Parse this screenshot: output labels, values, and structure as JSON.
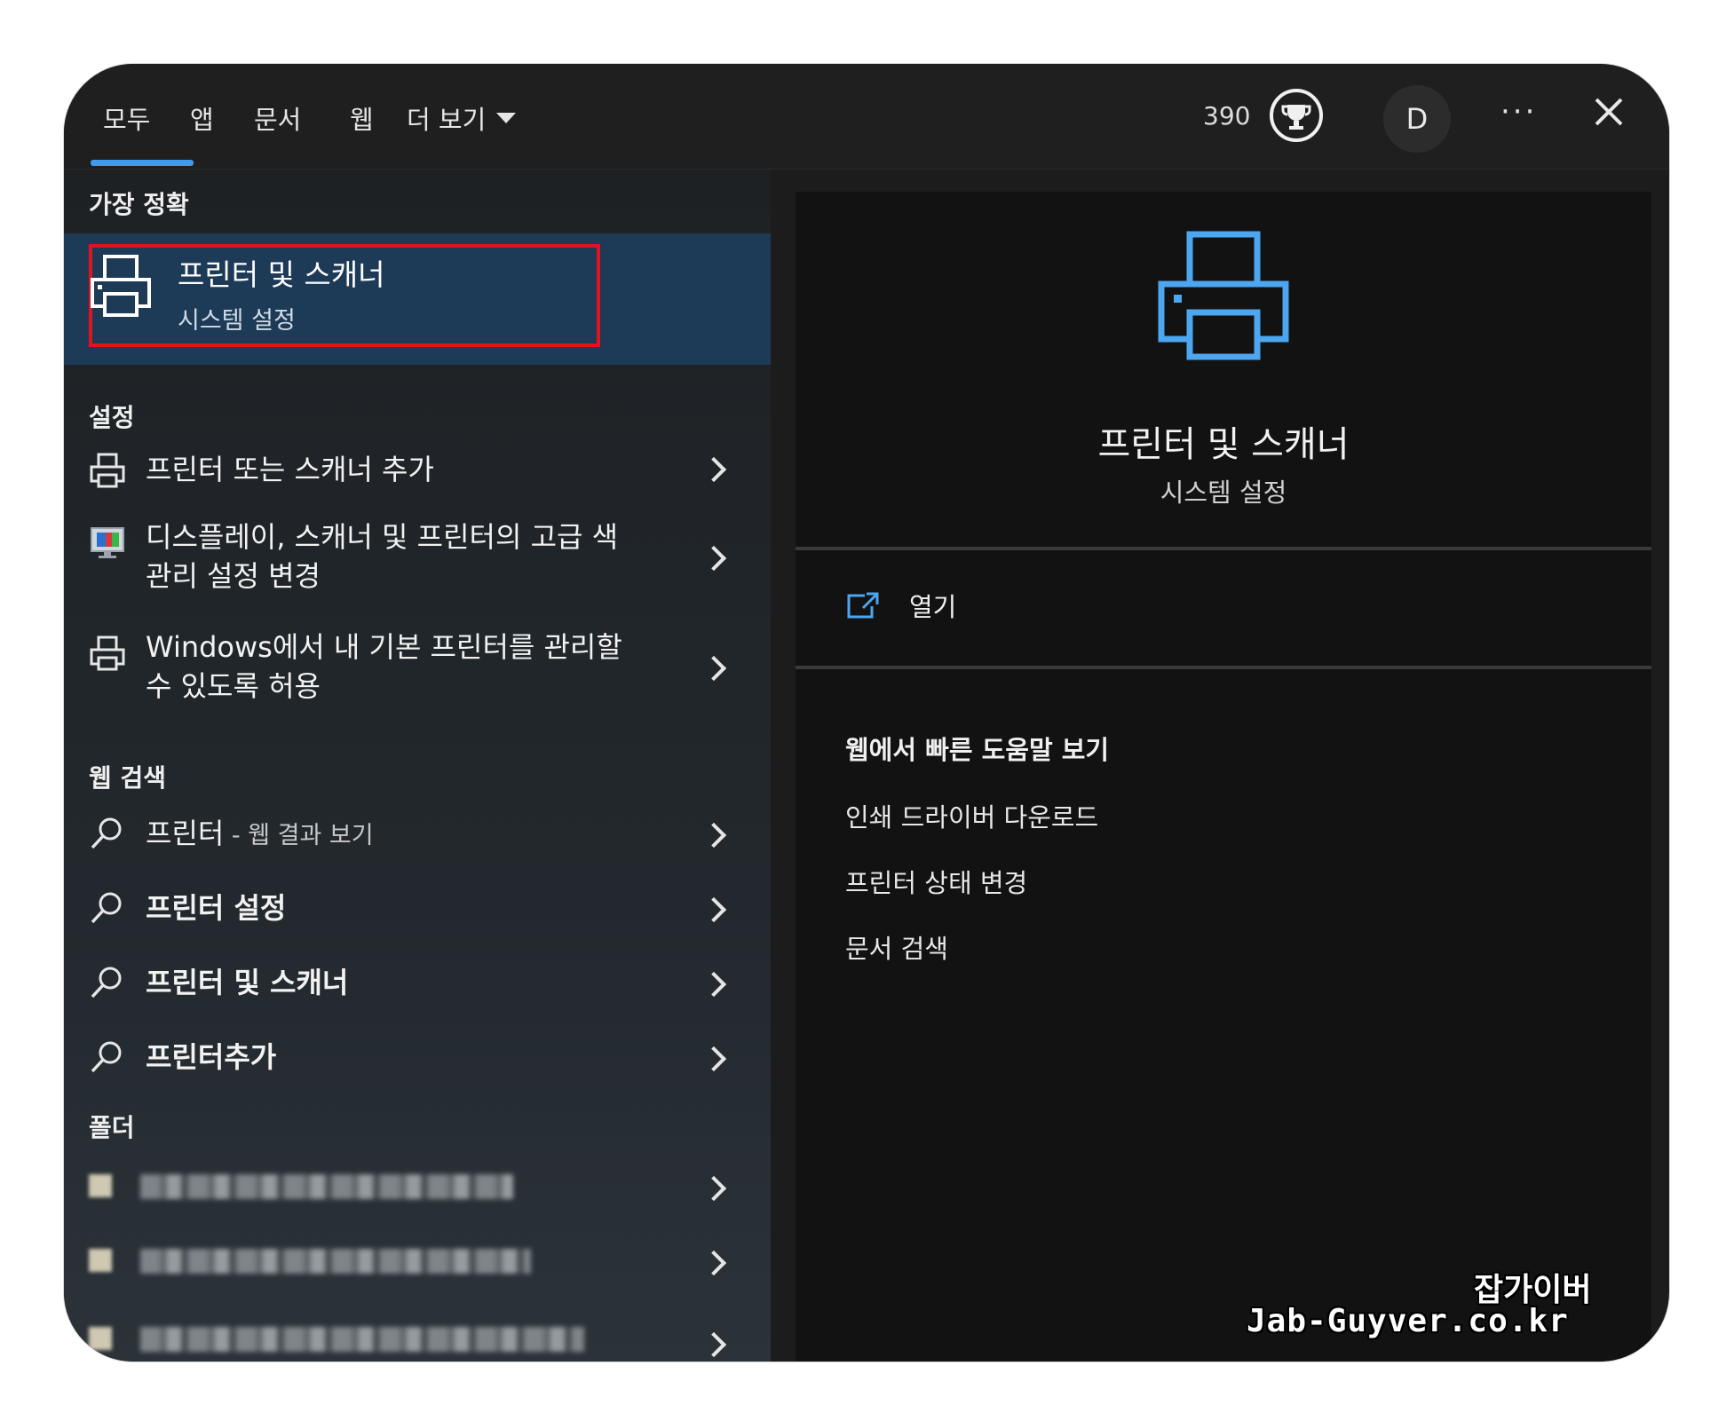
{
  "tabs": [
    {
      "label": "모두"
    },
    {
      "label": "앱"
    },
    {
      "label": "문서"
    },
    {
      "label": "웹"
    },
    {
      "label": "더 보기"
    }
  ],
  "header": {
    "points": "390",
    "avatar_initial": "D"
  },
  "left": {
    "best_match_title": "가장 정확",
    "best_match": {
      "title": "프린터 및 스캐너",
      "subtitle": "시스템 설정"
    },
    "settings_title": "설정",
    "settings_items": [
      {
        "label": "프린터 또는 스캐너 추가",
        "icon": "printer-icon"
      },
      {
        "label": "디스플레이, 스캐너 및 프린터의 고급 색 관리 설정 변경",
        "icon": "display-color-icon"
      },
      {
        "label": "Windows에서 내 기본 프린터를 관리할 수 있도록 허용",
        "icon": "printer-icon"
      }
    ],
    "web_title": "웹 검색",
    "web_items": [
      {
        "label": "프린터",
        "suffix": " - 웹 결과 보기",
        "icon": "search-icon"
      },
      {
        "label": "프린터 설정",
        "icon": "search-icon"
      },
      {
        "label": "프린터 및 스캐너",
        "icon": "search-icon"
      },
      {
        "label": "프린터추가",
        "icon": "search-icon"
      }
    ],
    "folder_title": "폴더"
  },
  "right": {
    "title": "프린터 및 스캐너",
    "subtitle": "시스템 설정",
    "open_label": "열기",
    "help_title": "웹에서 빠른 도움말 보기",
    "help_links": [
      "인쇄 드라이버 다운로드",
      "프린터 상태 변경",
      "문서 검색"
    ]
  },
  "watermark": {
    "line1": "잡가이버",
    "line2": "Jab-Guyver.co.kr"
  },
  "colors": {
    "accent": "#3d9bf0",
    "highlight": "#1d3a57",
    "annotation": "#e0141e"
  }
}
